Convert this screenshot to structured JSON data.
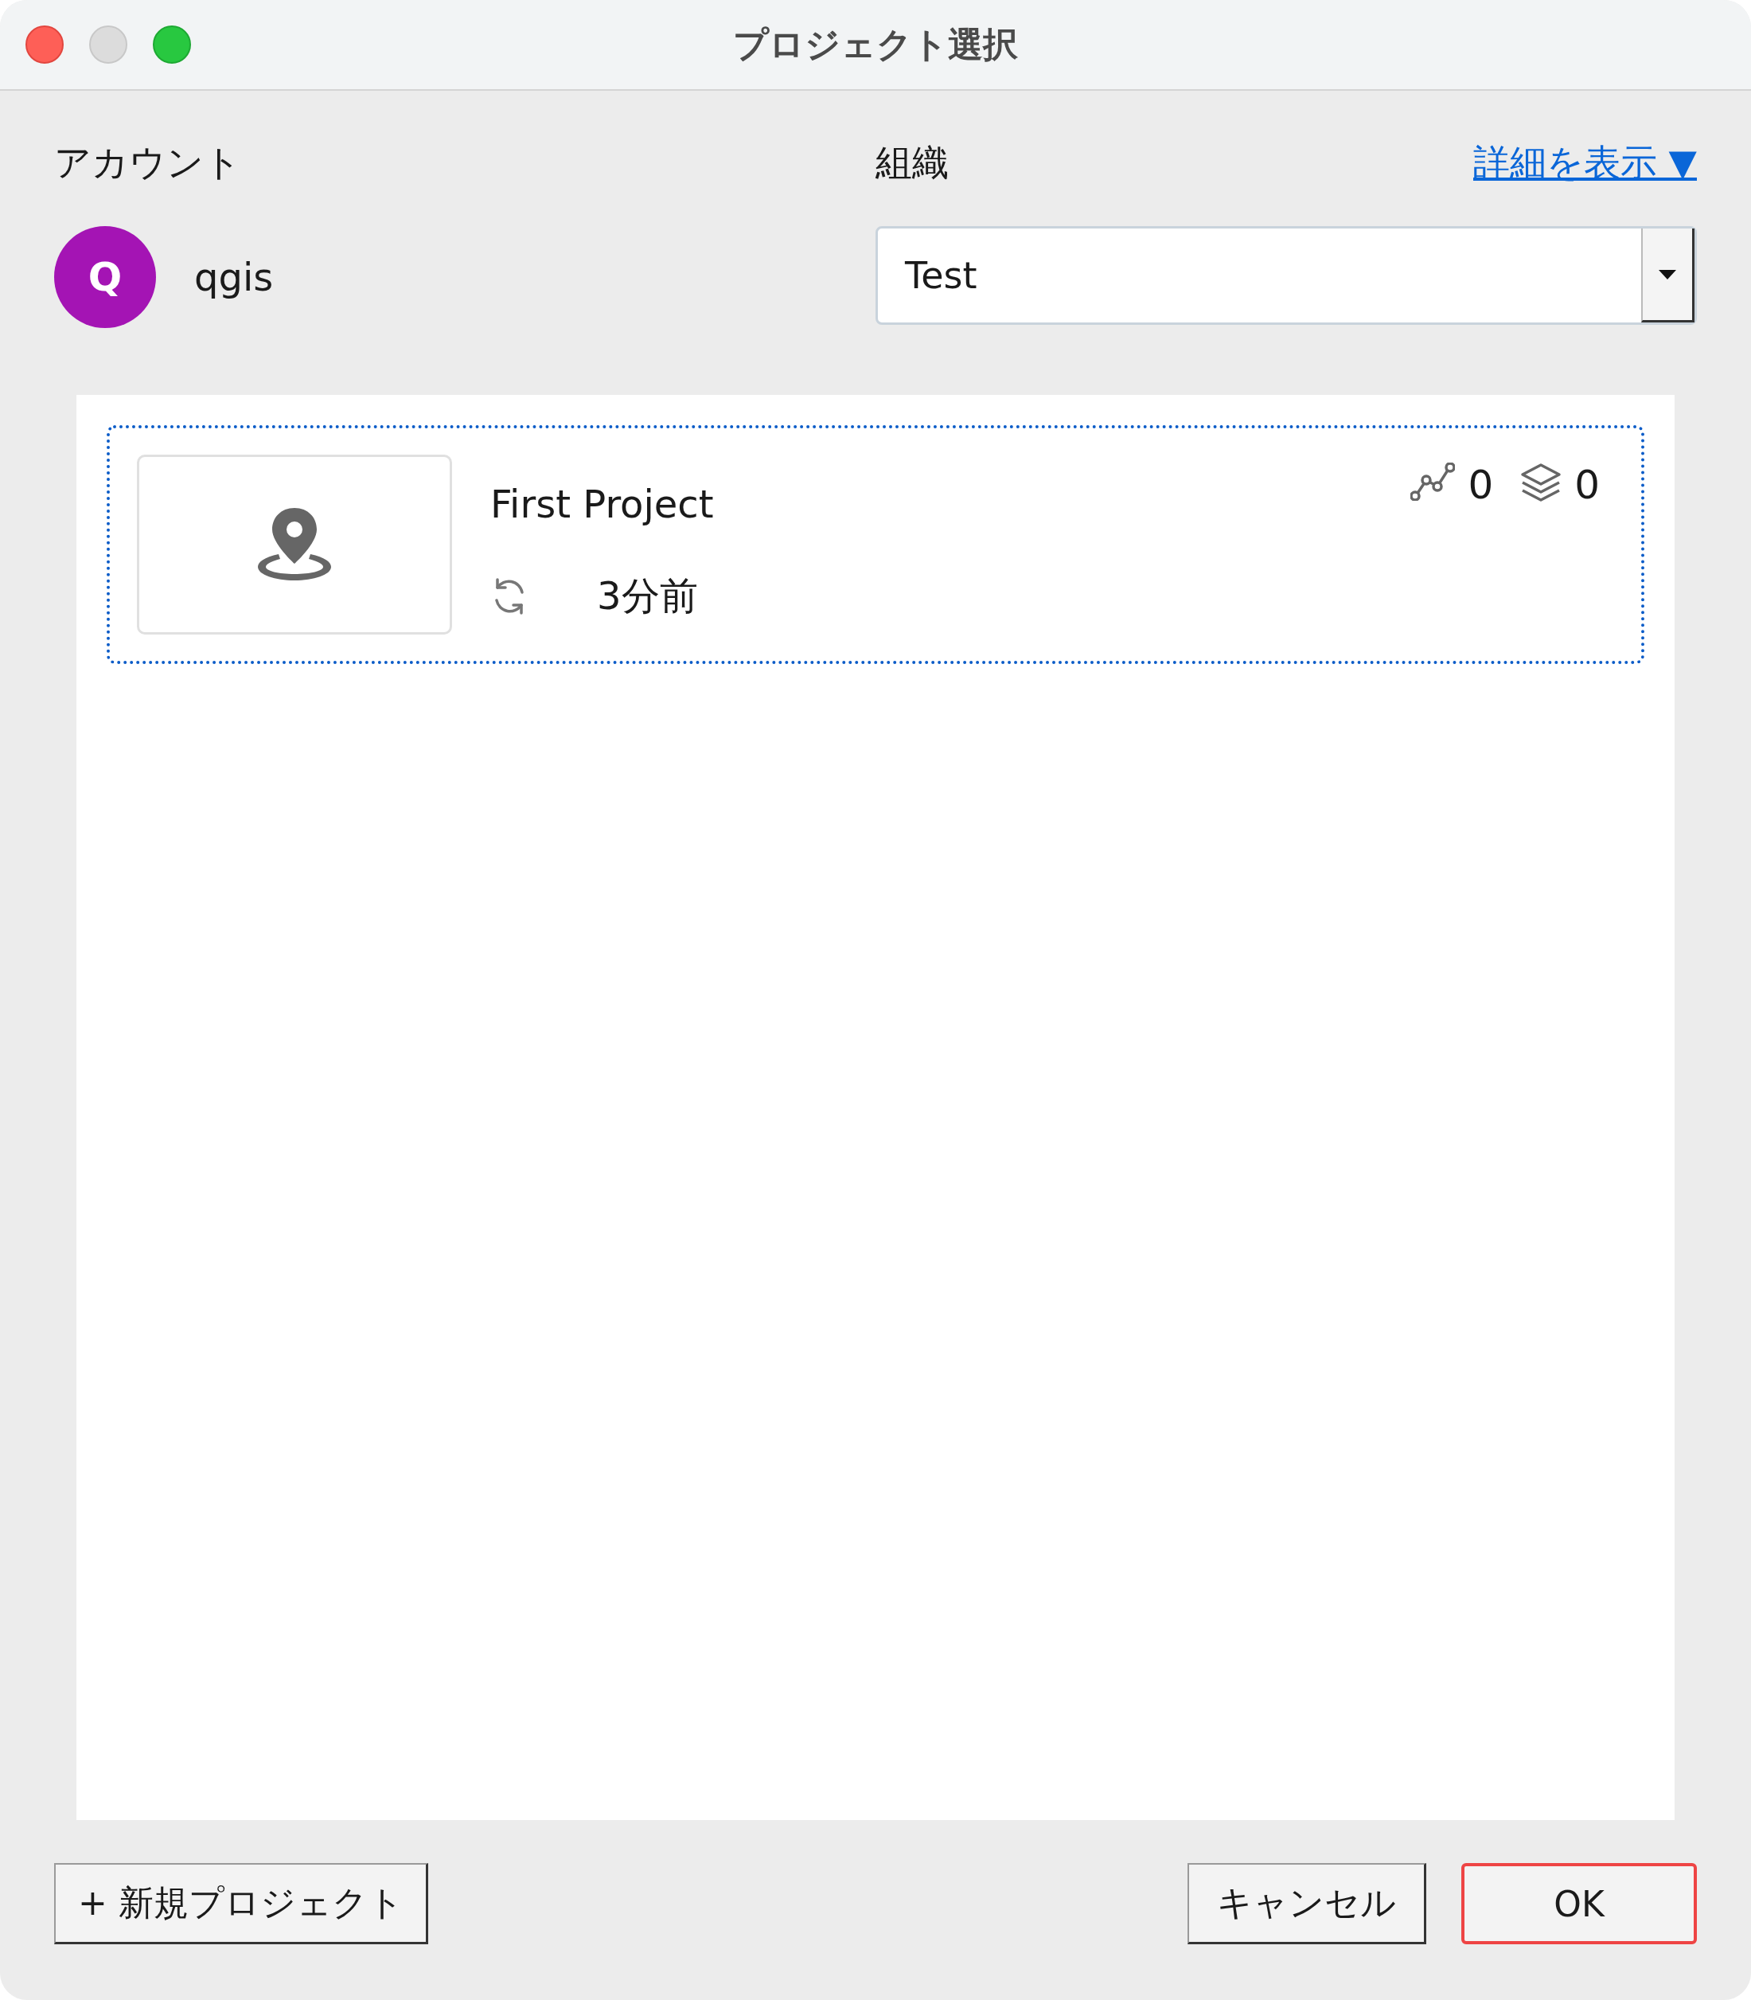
{
  "window": {
    "title": "プロジェクト選択"
  },
  "account": {
    "label": "アカウント",
    "avatar_letter": "Q",
    "name": "qgis"
  },
  "organization": {
    "label": "組織",
    "value": "Test"
  },
  "details_link": "詳細を表示 ▼",
  "projects": [
    {
      "name": "First Project",
      "sync_time": "3分前",
      "line_count": "0",
      "layer_count": "0",
      "selected": true
    }
  ],
  "buttons": [
    {
      "label": "+ 新規プロジェクト",
      "focused": false
    },
    {
      "label": "キャンセル",
      "focused": false
    },
    {
      "label": "OK",
      "focused": true
    }
  ]
}
